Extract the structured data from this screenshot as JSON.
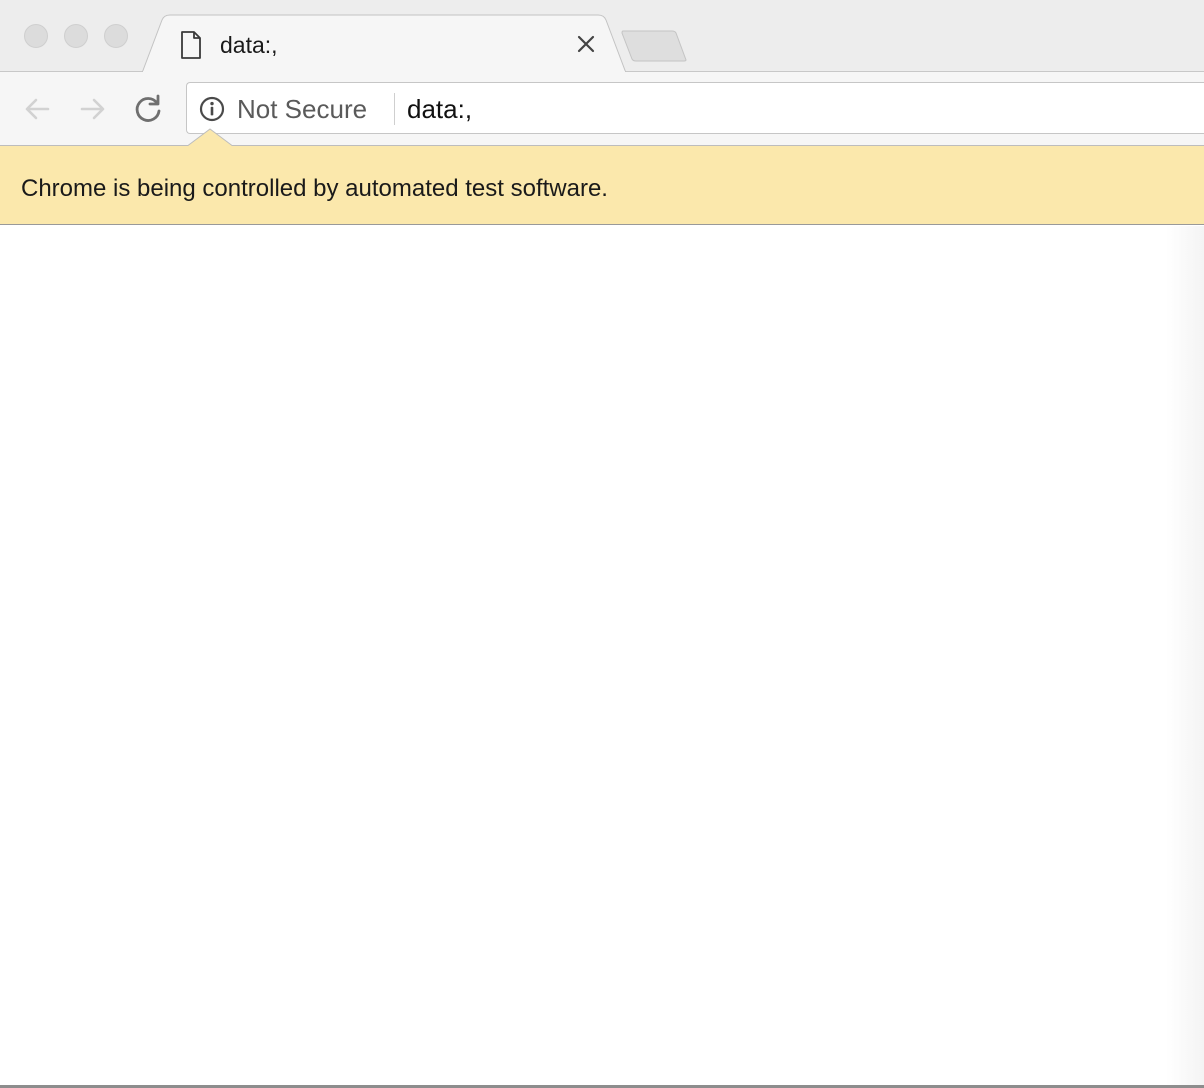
{
  "window": {
    "controls": [
      "close-icon",
      "minimize-icon",
      "zoom-icon"
    ]
  },
  "tab": {
    "icon": "document-icon",
    "title": "data:,",
    "close_icon": "close-icon"
  },
  "toolbar": {
    "back_icon": "arrow-left-icon",
    "forward_icon": "arrow-right-icon",
    "reload_icon": "reload-icon"
  },
  "omnibox": {
    "security_icon": "info-icon",
    "security_label": "Not Secure",
    "url": "data:,"
  },
  "infobar": {
    "message": "Chrome is being controlled by automated test software.",
    "background_color": "#fbe8ac"
  },
  "colors": {
    "tabstrip": "#ededed",
    "toolbar": "#f6f6f6",
    "page": "#ffffff"
  }
}
